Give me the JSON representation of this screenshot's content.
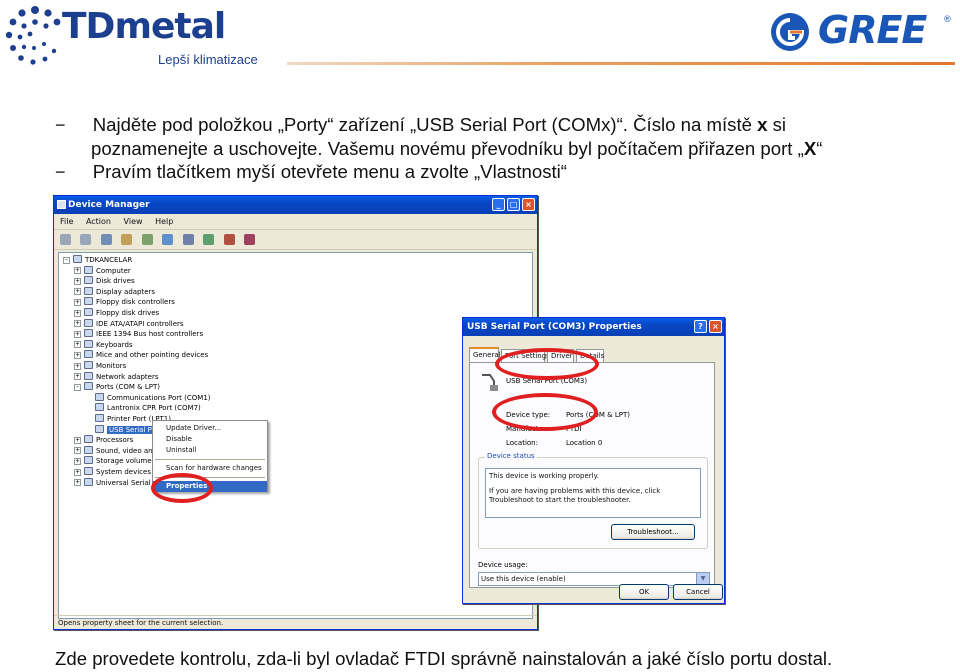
{
  "header": {
    "td_brand": "TDmetal",
    "td_subtitle": "Lepší klimatizace",
    "gree_brand": "GREE",
    "gree_reg": "®"
  },
  "instructions": {
    "line1_pre": "Najděte pod položkou „Porty“ zařízení „USB Serial Port (COMx)“. Číslo na místě ",
    "line1_bold": "x",
    "line1_post": " si",
    "line2_a": "poznamenejte a uschovejte.",
    "line2_b": " Vašemu novému převodníku byl počítačem přiřazen port „",
    "line2_bold": "X",
    "line2_end": "“",
    "line3": "Pravím tlačítkem myší otevřete menu a zvolte „Vlastnosti“",
    "dash": "−"
  },
  "device_manager": {
    "title": "Device Manager",
    "menu": [
      "File",
      "Action",
      "View",
      "Help"
    ],
    "tree": [
      {
        "label": "TDKANCELAR",
        "level": 0,
        "expander": "-"
      },
      {
        "label": "Computer",
        "level": 1,
        "expander": "+"
      },
      {
        "label": "Disk drives",
        "level": 1,
        "expander": "+"
      },
      {
        "label": "Display adapters",
        "level": 1,
        "expander": "+"
      },
      {
        "label": "Floppy disk controllers",
        "level": 1,
        "expander": "+"
      },
      {
        "label": "Floppy disk drives",
        "level": 1,
        "expander": "+"
      },
      {
        "label": "IDE ATA/ATAPI controllers",
        "level": 1,
        "expander": "+"
      },
      {
        "label": "IEEE 1394 Bus host controllers",
        "level": 1,
        "expander": "+"
      },
      {
        "label": "Keyboards",
        "level": 1,
        "expander": "+"
      },
      {
        "label": "Mice and other pointing devices",
        "level": 1,
        "expander": "+"
      },
      {
        "label": "Monitors",
        "level": 1,
        "expander": "+"
      },
      {
        "label": "Network adapters",
        "level": 1,
        "expander": "+"
      },
      {
        "label": "Ports (COM & LPT)",
        "level": 1,
        "expander": "-"
      },
      {
        "label": "Communications Port (COM1)",
        "level": 2,
        "expander": ""
      },
      {
        "label": "Lantronix CPR Port (COM7)",
        "level": 2,
        "expander": ""
      },
      {
        "label": "Printer Port (LPT1)",
        "level": 2,
        "expander": ""
      },
      {
        "label": "USB Serial Port (COM3)",
        "level": 2,
        "expander": "",
        "selected": true
      },
      {
        "label": "Processors",
        "level": 1,
        "expander": "+"
      },
      {
        "label": "Sound, video and",
        "level": 1,
        "expander": "+"
      },
      {
        "label": "Storage volumes",
        "level": 1,
        "expander": "+"
      },
      {
        "label": "System devices",
        "level": 1,
        "expander": "+"
      },
      {
        "label": "Universal Serial Bu",
        "level": 1,
        "expander": "+"
      }
    ],
    "status": "Opens property sheet for the current selection."
  },
  "context_menu": {
    "update_driver": "Update Driver...",
    "disable": "Disable",
    "uninstall": "Uninstall",
    "scan": "Scan for hardware changes",
    "properties": "Properties"
  },
  "properties_dialog": {
    "title": "USB Serial Port (COM3) Properties",
    "tabs": [
      "General",
      "Port Settings",
      "Driver",
      "Details"
    ],
    "device_name": "USB Serial Port (COM3)",
    "device_type_label": "Device type:",
    "device_type_value": "Ports (COM & LPT)",
    "manufacturer_label": "Manufacturer:",
    "manufacturer_value": "FTDI",
    "location_label": "Location:",
    "location_value": "Location 0",
    "status_group": "Device status",
    "status_text1": "This device is working properly.",
    "status_text2": "If you are having problems with this device, click Troubleshoot to start the troubleshooter.",
    "troubleshoot": "Troubleshoot...",
    "usage_label": "Device usage:",
    "usage_value": "Use this device (enable)",
    "ok": "OK",
    "cancel": "Cancel"
  },
  "footer": {
    "text": "Zde provedete kontrolu, zda-li byl ovladač FTDI správně nainstalován a jaké číslo portu dostal."
  },
  "colors": {
    "accent_red": "#e02020",
    "xp_blue": "#0747c2",
    "td_blue": "#1c3f8f",
    "gree_blue": "#1a56b5"
  }
}
